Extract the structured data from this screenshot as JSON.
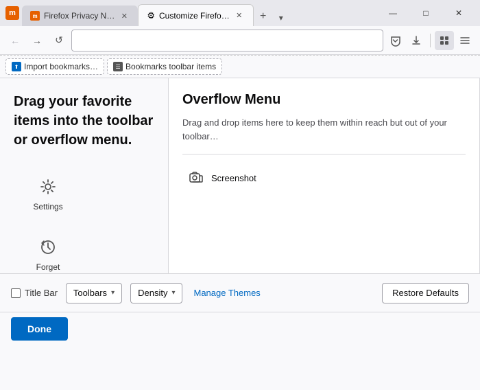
{
  "browser": {
    "tabs": [
      {
        "id": "tab-1",
        "label": "Firefox Privacy N…",
        "favicon_char": "m",
        "active": false
      },
      {
        "id": "tab-2",
        "label": "Customize Firefo…",
        "favicon_char": "⚙",
        "active": true
      }
    ],
    "add_tab_label": "+",
    "tab_dropdown_label": "▾",
    "window_controls": {
      "minimize": "—",
      "maximize": "□",
      "close": "✕"
    }
  },
  "nav": {
    "back_icon": "←",
    "forward_icon": "→",
    "reload_icon": "↺",
    "search_icon": "🔍",
    "pocket_icon": "☰",
    "download_icon": "⬇",
    "extensions_icon": "≡",
    "menu_icon": "☰"
  },
  "bookmarks_bar": {
    "items": [
      {
        "label": "Import bookmarks…"
      },
      {
        "label": "Bookmarks toolbar items"
      }
    ]
  },
  "left_panel": {
    "drag_text": "Drag your favorite items into the toolbar or overflow menu.",
    "toolbar_items": [
      {
        "id": "settings",
        "label": "Settings"
      },
      {
        "id": "forget",
        "label": "Forget"
      }
    ]
  },
  "overflow_menu": {
    "title": "Overflow Menu",
    "description": "Drag and drop items here to keep them within reach but out of your toolbar…",
    "items": [
      {
        "id": "screenshot",
        "label": "Screenshot"
      }
    ]
  },
  "bottom_bar": {
    "title_bar_label": "Title Bar",
    "toolbars_label": "Toolbars",
    "density_label": "Density",
    "manage_themes_label": "Manage Themes",
    "restore_defaults_label": "Restore Defaults",
    "dropdown_arrow": "▾"
  },
  "done_bar": {
    "done_label": "Done"
  }
}
